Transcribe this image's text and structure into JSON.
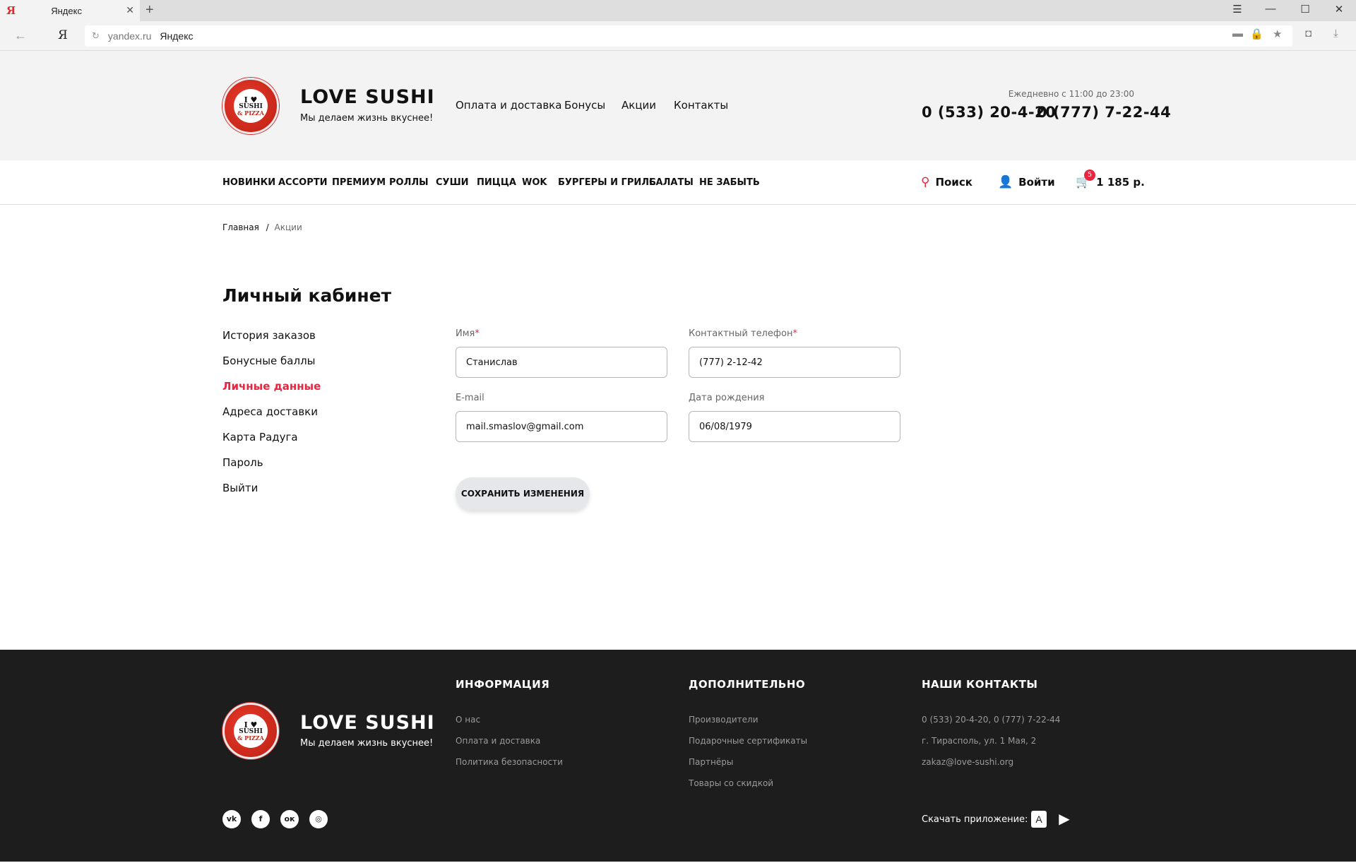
{
  "browser": {
    "tab_title": "Яндекс",
    "favicon": "Я",
    "address_domain": "yandex.ru",
    "address_page": "Яндекс",
    "omnibox_logo": "Я"
  },
  "site": {
    "brand_name": "LOVE SUSHI",
    "slogan": "Мы делаем жизнь вкуснее!",
    "logo_text": [
      "I ♥",
      "SUSHI",
      "& PIZZA"
    ],
    "top_nav": [
      "Оплата и доставка",
      "Бонусы",
      "Акции",
      "Контакты"
    ],
    "hours": "Ежедневно с 11:00 до 23:00",
    "phones": [
      "0 (533) 20-4-20",
      "0 (777) 7-22-44"
    ],
    "categories": [
      "НОВИНКИ",
      "АССОРТИ",
      "ПРЕМИУМ",
      "РОЛЛЫ",
      "СУШИ",
      "ПИЦЦА",
      "WOK",
      "БУРГЕРЫ И ГРИЛЬ",
      "САЛАТЫ",
      "НЕ ЗАБЫТЬ"
    ],
    "search_label": "Поиск",
    "login_label": "Войти",
    "cart_count": "5",
    "cart_total": "1 185 р.",
    "accent_color": "#e8263f"
  },
  "breadcrumb": {
    "home": "Главная",
    "sep": "/",
    "current": "Акции"
  },
  "account": {
    "title": "Личный кабинет",
    "menu": [
      "История заказов",
      "Бонусные баллы",
      "Личные данные",
      "Адреса доставки",
      "Карта Радуга",
      "Пароль",
      "Выйти"
    ],
    "active_index": 2,
    "form": {
      "name_label": "Имя",
      "name_value": "Станислав",
      "phone_label": "Контактный телефон",
      "phone_value": "(777) 2-12-42",
      "email_label": "E-mail",
      "email_value": "mail.smaslov@gmail.com",
      "birth_label": "Дата рождения",
      "birth_value": "06/08/1979",
      "required_mark": "*",
      "save_label": "СОХРАНИТЬ ИЗМЕНЕНИЯ"
    }
  },
  "footer": {
    "info_title": "ИНФОРМАЦИЯ",
    "info_links": [
      "О нас",
      "Оплата и доставка",
      "Политика безопасности"
    ],
    "extra_title": "ДОПОЛНИТЕЛЬНО",
    "extra_links": [
      "Производители",
      "Подарочные сертификаты",
      "Партнёры",
      "Товары со скидкой"
    ],
    "contacts_title": "НАШИ КОНТАКТЫ",
    "contacts": [
      "0 (533) 20-4-20, 0 (777) 7-22-44",
      "г. Тирасполь, ул. 1 Мая, 2",
      "zakaz@love-sushi.org"
    ],
    "social_icons": [
      "vk-icon",
      "facebook-icon",
      "odnoklassniki-icon",
      "instagram-icon"
    ],
    "app_label": "Скачать приложение:",
    "store_icons": [
      "app-store-icon",
      "google-play-icon"
    ]
  }
}
